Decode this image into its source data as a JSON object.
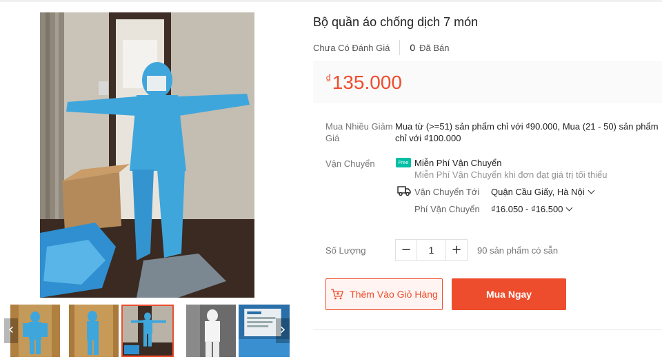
{
  "product": {
    "title": "Bộ quần áo chống dịch 7 món",
    "rating_text": "Chưa Có Đánh Giá",
    "sold_count": "0",
    "sold_label": "Đã Bán",
    "price_currency": "₫",
    "price_value": "135.000"
  },
  "discount": {
    "label": "Mua Nhiều Giảm Giá",
    "text": "Mua từ (>=51) sản phẩm chỉ với ₫90.000, Mua (21 - 50) sản phẩm chỉ với ₫100.000"
  },
  "shipping": {
    "label": "Vận Chuyển",
    "free_badge": "Free",
    "free_title": "Miễn Phí Vận Chuyển",
    "free_desc": "Miễn Phí Vận Chuyển khi đơn đạt giá trị tối thiểu",
    "to_label": "Vận Chuyển Tới",
    "to_value": "Quận Cầu Giấy, Hà Nội",
    "fee_label": "Phí Vận Chuyển",
    "fee_value": "₫16.050 - ₫16.500"
  },
  "quantity": {
    "label": "Số Lượng",
    "minus": "−",
    "plus": "+",
    "value": "1",
    "stock_text": "90 sản phẩm có sẵn"
  },
  "actions": {
    "add_to_cart": "Thêm Vào Giỏ Hàng",
    "buy_now": "Mua Ngay"
  },
  "gallery": {
    "prev_arrow": "‹",
    "next_arrow": "›",
    "active_thumb": 3,
    "thumb_count": 5
  },
  "colors": {
    "accent": "#ee4d2d",
    "suit": "#3fa6dc",
    "free_badge": "#00bfa5"
  },
  "icons": {
    "cart": "add-to-cart-icon",
    "truck": "truck-icon",
    "free_shipping": "free-shipping-icon",
    "chevron": "chevron-down-icon"
  }
}
